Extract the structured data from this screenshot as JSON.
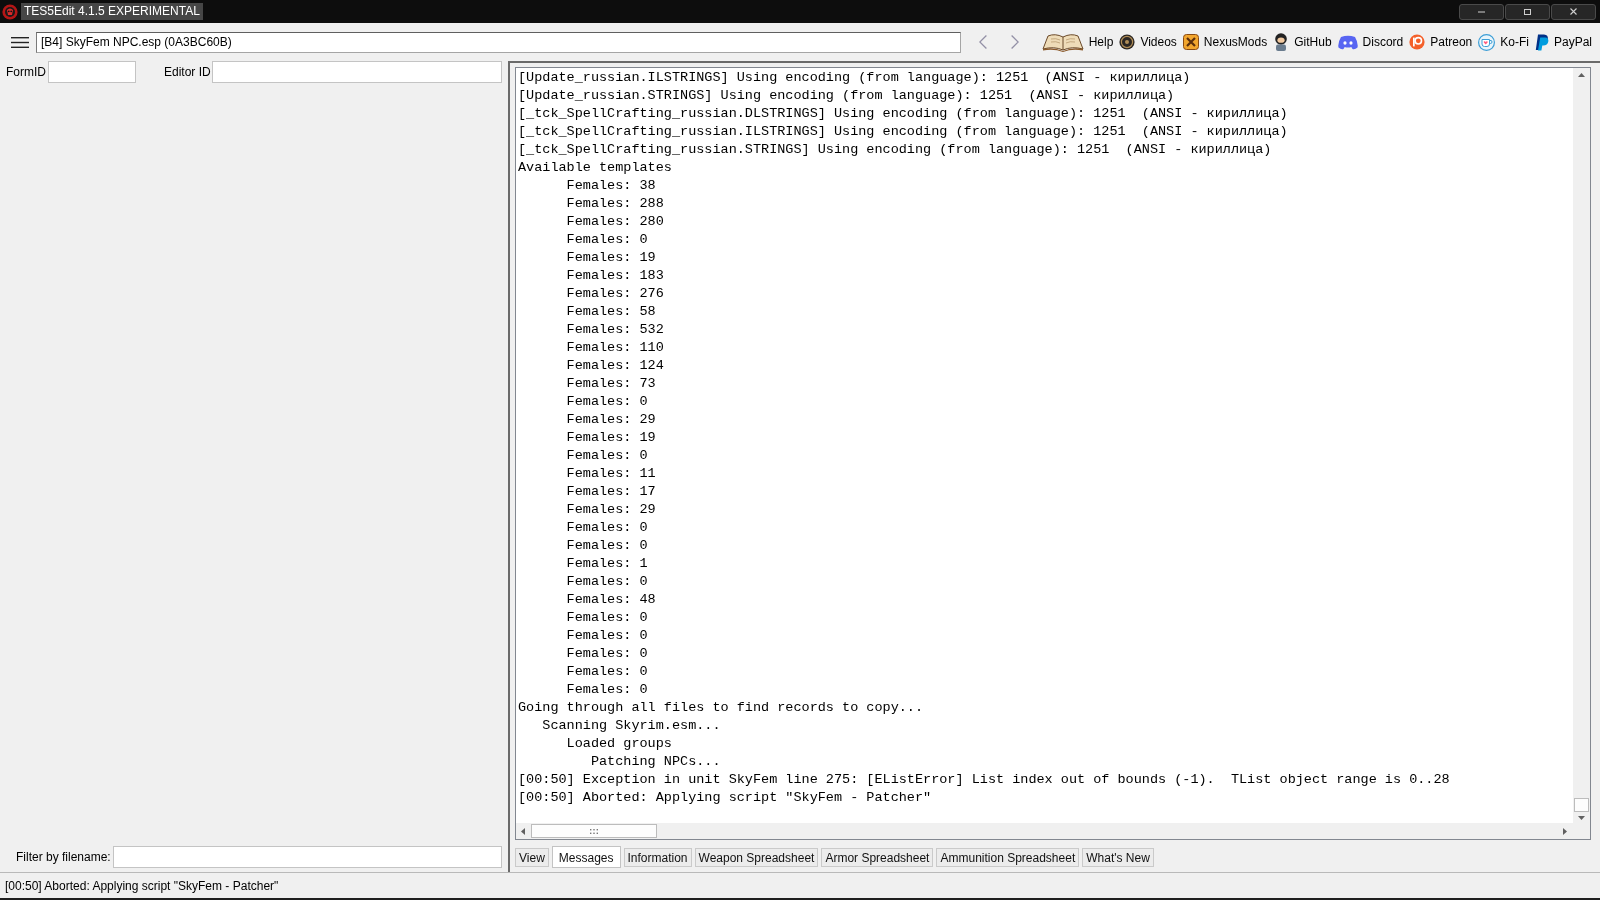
{
  "window": {
    "title": "TES5Edit 4.1.5 EXPERIMENTAL"
  },
  "toolbar": {
    "record_path": "[B4] SkyFem NPC.esp (0A3BC60B)",
    "links": [
      {
        "kind": "book",
        "label": "Help"
      },
      {
        "kind": "disc",
        "label": "Videos"
      },
      {
        "kind": "tile",
        "label": "NexusMods"
      },
      {
        "kind": "figure",
        "label": "GitHub"
      },
      {
        "kind": "gamepad",
        "label": "Discord"
      },
      {
        "kind": "ring",
        "label": "Patreon"
      },
      {
        "kind": "cup",
        "label": "Ko-Fi"
      },
      {
        "kind": "flag",
        "label": "PayPal"
      }
    ]
  },
  "navigator": {
    "form_id_label": "FormID",
    "editor_id_label": "Editor ID",
    "filter_label": "Filter by filename:"
  },
  "messages": {
    "lines": [
      "[Update_russian.ILSTRINGS] Using encoding (from language): 1251  (ANSI - кириллица)",
      "[Update_russian.STRINGS] Using encoding (from language): 1251  (ANSI - кириллица)",
      "[_tck_SpellCrafting_russian.DLSTRINGS] Using encoding (from language): 1251  (ANSI - кириллица)",
      "[_tck_SpellCrafting_russian.ILSTRINGS] Using encoding (from language): 1251  (ANSI - кириллица)",
      "[_tck_SpellCrafting_russian.STRINGS] Using encoding (from language): 1251  (ANSI - кириллица)",
      "Available templates",
      "      Females: 38",
      "      Females: 288",
      "      Females: 280",
      "      Females: 0",
      "      Females: 19",
      "      Females: 183",
      "      Females: 276",
      "      Females: 58",
      "      Females: 532",
      "      Females: 110",
      "      Females: 124",
      "      Females: 73",
      "      Females: 0",
      "      Females: 29",
      "      Females: 19",
      "      Females: 0",
      "      Females: 11",
      "      Females: 17",
      "      Females: 29",
      "      Females: 0",
      "      Females: 0",
      "      Females: 1",
      "      Females: 0",
      "      Females: 48",
      "      Females: 0",
      "      Females: 0",
      "      Females: 0",
      "      Females: 0",
      "      Females: 0",
      "Going through all files to find records to copy...",
      "   Scanning Skyrim.esm...",
      "      Loaded groups",
      "         Patching NPCs...",
      "[00:50] Exception in unit SkyFem line 275: [EListError] List index out of bounds (-1).  TList object range is 0..28",
      "[00:50] Aborted: Applying script \"SkyFem - Patcher\""
    ]
  },
  "tabs": [
    {
      "label": "View",
      "selected": false
    },
    {
      "label": "Messages",
      "selected": true
    },
    {
      "label": "Information",
      "selected": false
    },
    {
      "label": "Weapon Spreadsheet",
      "selected": false
    },
    {
      "label": "Armor Spreadsheet",
      "selected": false
    },
    {
      "label": "Ammunition Spreadsheet",
      "selected": false
    },
    {
      "label": "What's New",
      "selected": false
    }
  ],
  "status_bar": {
    "text": "[00:50] Aborted: Applying script \"SkyFem - Patcher\""
  }
}
